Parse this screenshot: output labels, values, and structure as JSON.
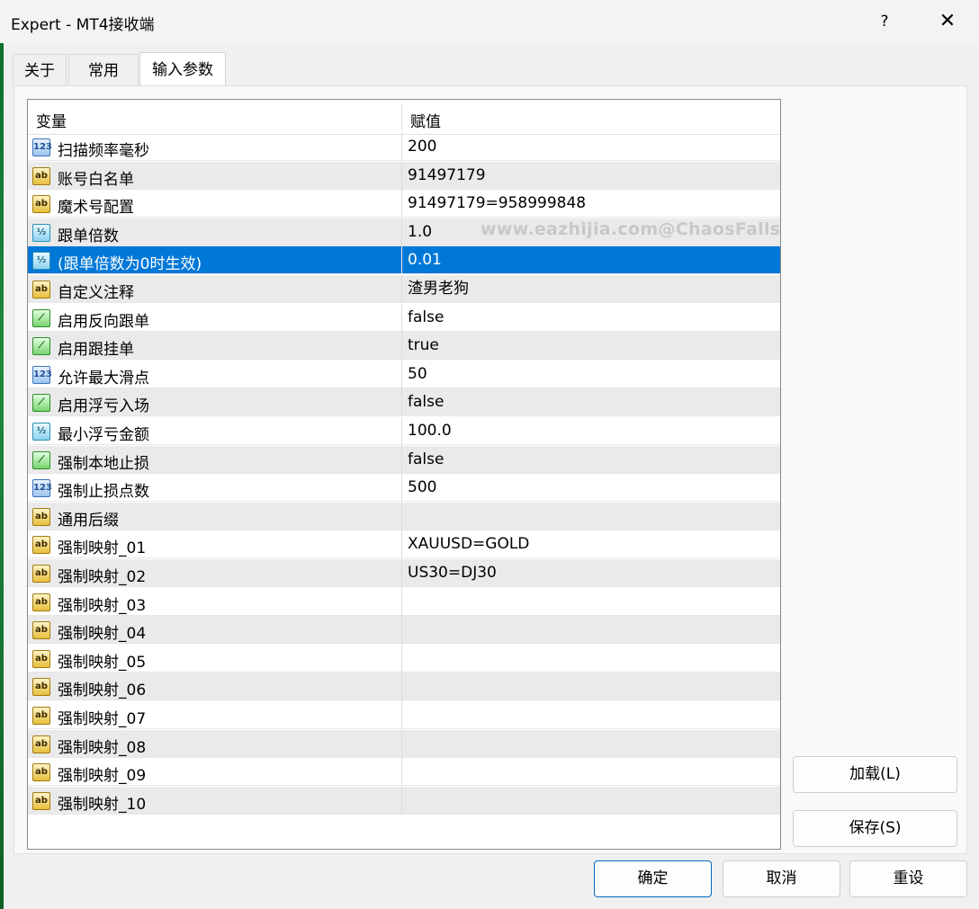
{
  "window": {
    "title": "Expert - MT4接收端",
    "help_label": "?",
    "close_label": "✕"
  },
  "tabs": [
    {
      "label": "关于"
    },
    {
      "label": "常用"
    },
    {
      "label": "输入参数",
      "active": true
    }
  ],
  "grid": {
    "col_variable": "变量",
    "col_value": "赋值",
    "watermark": "www.eazhijia.com@ChaosFalls",
    "rows": [
      {
        "type": "int",
        "icon": "123",
        "name": "扫描频率毫秒",
        "value": "200"
      },
      {
        "type": "string",
        "icon": "ab",
        "name": "账号白名单",
        "value": "91497179"
      },
      {
        "type": "string",
        "icon": "ab",
        "name": "魔术号配置",
        "value": "91497179=958999848"
      },
      {
        "type": "double",
        "icon": "½",
        "name": "跟单倍数",
        "value": "1.0"
      },
      {
        "type": "double",
        "icon": "½",
        "name": "(跟单倍数为0时生效)",
        "value": "0.01",
        "selected": true
      },
      {
        "type": "string",
        "icon": "ab",
        "name": "自定义注释",
        "value": "渣男老狗"
      },
      {
        "type": "bool",
        "icon": "⟋",
        "name": "启用反向跟单",
        "value": "false"
      },
      {
        "type": "bool",
        "icon": "⟋",
        "name": "启用跟挂单",
        "value": "true"
      },
      {
        "type": "int",
        "icon": "123",
        "name": "允许最大滑点",
        "value": "50"
      },
      {
        "type": "bool",
        "icon": "⟋",
        "name": "启用浮亏入场",
        "value": "false"
      },
      {
        "type": "double",
        "icon": "½",
        "name": "最小浮亏金额",
        "value": "100.0"
      },
      {
        "type": "bool",
        "icon": "⟋",
        "name": "强制本地止损",
        "value": "false"
      },
      {
        "type": "int",
        "icon": "123",
        "name": "强制止损点数",
        "value": "500"
      },
      {
        "type": "string",
        "icon": "ab",
        "name": "通用后缀",
        "value": ""
      },
      {
        "type": "string",
        "icon": "ab",
        "name": "强制映射_01",
        "value": "XAUUSD=GOLD"
      },
      {
        "type": "string",
        "icon": "ab",
        "name": "强制映射_02",
        "value": "US30=DJ30"
      },
      {
        "type": "string",
        "icon": "ab",
        "name": "强制映射_03",
        "value": ""
      },
      {
        "type": "string",
        "icon": "ab",
        "name": "强制映射_04",
        "value": ""
      },
      {
        "type": "string",
        "icon": "ab",
        "name": "强制映射_05",
        "value": ""
      },
      {
        "type": "string",
        "icon": "ab",
        "name": "强制映射_06",
        "value": ""
      },
      {
        "type": "string",
        "icon": "ab",
        "name": "强制映射_07",
        "value": ""
      },
      {
        "type": "string",
        "icon": "ab",
        "name": "强制映射_08",
        "value": ""
      },
      {
        "type": "string",
        "icon": "ab",
        "name": "强制映射_09",
        "value": ""
      },
      {
        "type": "string",
        "icon": "ab",
        "name": "强制映射_10",
        "value": ""
      }
    ]
  },
  "side_buttons": {
    "load": "加载(L)",
    "save": "保存(S)"
  },
  "bottom_buttons": {
    "ok": "确定",
    "cancel": "取消",
    "reset": "重设"
  },
  "colors": {
    "selection": "#0078d7",
    "alt_row": "#eaeaea",
    "accent_border": "#0067c0"
  }
}
